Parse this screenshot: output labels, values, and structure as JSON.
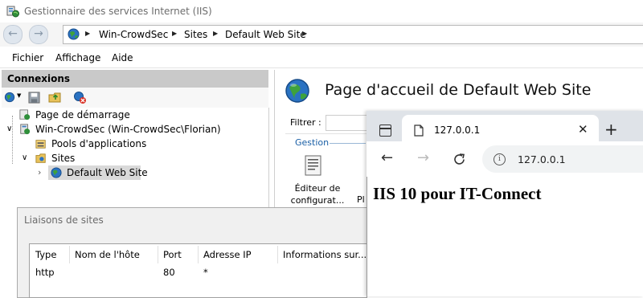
{
  "window": {
    "title": "Gestionnaire des services Internet (IIS)"
  },
  "address": {
    "crumbs": [
      "Win-CrowdSec",
      "Sites",
      "Default Web Site"
    ]
  },
  "menu": {
    "items": [
      "Fichier",
      "Affichage",
      "Aide"
    ]
  },
  "connections": {
    "title": "Connexions",
    "tree": [
      {
        "label": "Page de démarrage"
      },
      {
        "label": "Win-CrowdSec (Win-CrowdSec\\Florian)"
      },
      {
        "label": "Pools d'applications"
      },
      {
        "label": "Sites"
      },
      {
        "label": "Default Web Site"
      }
    ]
  },
  "main": {
    "title": "Page d'accueil de Default Web Site",
    "filter_label": "Filtrer :",
    "group": "Gestion",
    "feature_label_1": "Éditeur de",
    "feature_label_2": "configurat...",
    "feature_partial": "Pl"
  },
  "dialog": {
    "title": "Liaisons de sites",
    "columns": [
      "Type",
      "Nom de l'hôte",
      "Port",
      "Adresse IP",
      "Informations sur..."
    ],
    "rows": [
      {
        "type": "http",
        "host": "",
        "port": "80",
        "ip": "*",
        "info": ""
      }
    ]
  },
  "browser": {
    "tab_title": "127.0.0.1",
    "url": "127.0.0.1",
    "heading": "IIS 10 pour IT-Connect"
  },
  "colors": {
    "selected_node": "#d9d9d9",
    "header_gray": "#c9c9c9",
    "link_blue": "#1a5fa6"
  }
}
